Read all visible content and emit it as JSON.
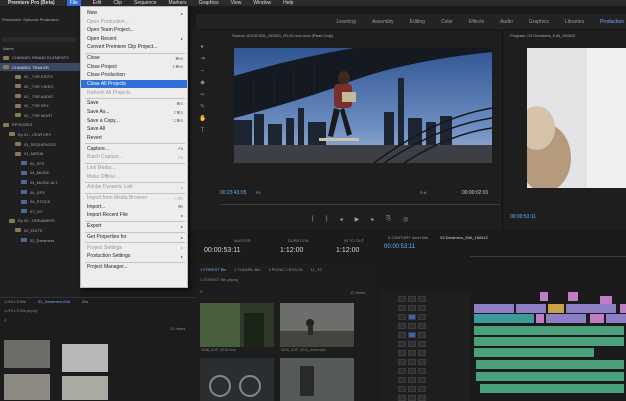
{
  "menubar": {
    "app": "Premiere Pro (Beta)",
    "items": [
      "File",
      "Edit",
      "Clip",
      "Sequence",
      "Markers",
      "Graphics",
      "View",
      "Window",
      "Help"
    ],
    "active": "File"
  },
  "workspaces": [
    "Learning",
    "Assembly",
    "Editing",
    "Color",
    "Effects",
    "Audio",
    "Graphics",
    "Libraries",
    "Production"
  ],
  "project": {
    "title": "Production: Episodic Production",
    "tree": [
      {
        "label": "Name",
        "indent": 0
      },
      {
        "label": "CHANNEL BRAND ELEMENTS",
        "indent": 0
      },
      {
        "label": "CHANNEL TRAILER",
        "indent": 0
      },
      {
        "label": "00 _TSR EDITS",
        "indent": 2
      },
      {
        "label": "00 _TSR VIDEO",
        "indent": 2
      },
      {
        "label": "00 _TSR AUDIO",
        "indent": 2
      },
      {
        "label": "00 _TSR SFX",
        "indent": 2
      },
      {
        "label": "00 _TSR MGRT",
        "indent": 2
      },
      {
        "label": "EPISODES",
        "indent": 0
      },
      {
        "label": "Ep 01 - CENTURY",
        "indent": 1
      },
      {
        "label": "01_SEQUENCES",
        "indent": 2
      },
      {
        "label": "01_MEDIA",
        "indent": 2
      },
      {
        "label": "04_SFX",
        "indent": 3
      },
      {
        "label": "04_MUSIC",
        "indent": 3
      },
      {
        "label": "04_MUSIC ALT",
        "indent": 3
      },
      {
        "label": "04_GFX",
        "indent": 3
      },
      {
        "label": "04_STOCK",
        "indent": 3
      },
      {
        "label": "07_VO",
        "indent": 3
      },
      {
        "label": "Ep 02 - DREAMERS",
        "indent": 1
      },
      {
        "label": "02_EDITS",
        "indent": 2
      },
      {
        "label": "02_Dreamers",
        "indent": 3
      }
    ]
  },
  "file_menu": {
    "items": [
      {
        "label": "New",
        "shortcut": "",
        "state": "normal",
        "arrow": true
      },
      {
        "label": "Open Production...",
        "shortcut": "",
        "state": "disabled"
      },
      {
        "label": "Open Team Project...",
        "shortcut": "",
        "state": "normal"
      },
      {
        "label": "Open Recent",
        "shortcut": "",
        "state": "normal",
        "arrow": true
      },
      {
        "label": "Convert Premiere Clip Project...",
        "shortcut": "",
        "state": "normal"
      },
      {
        "label": "Close",
        "shortcut": "⌘W",
        "state": "normal"
      },
      {
        "label": "Close Project",
        "shortcut": "⇧⌘W",
        "state": "normal"
      },
      {
        "label": "Close Production",
        "shortcut": "",
        "state": "normal"
      },
      {
        "label": "Close All Projects",
        "shortcut": "",
        "state": "highlighted"
      },
      {
        "label": "Refresh All Projects",
        "shortcut": "",
        "state": "disabled"
      },
      {
        "label": "Save",
        "shortcut": "⌘S",
        "state": "normal"
      },
      {
        "label": "Save As...",
        "shortcut": "⇧⌘S",
        "state": "normal"
      },
      {
        "label": "Save a Copy...",
        "shortcut": "⌥⌘S",
        "state": "normal"
      },
      {
        "label": "Save All",
        "shortcut": "",
        "state": "normal"
      },
      {
        "label": "Revert",
        "shortcut": "",
        "state": "normal"
      },
      {
        "label": "Capture...",
        "shortcut": "F5",
        "state": "normal"
      },
      {
        "label": "Batch Capture...",
        "shortcut": "F6",
        "state": "disabled"
      },
      {
        "label": "Link Media...",
        "shortcut": "",
        "state": "disabled"
      },
      {
        "label": "Make Offline...",
        "shortcut": "",
        "state": "disabled"
      },
      {
        "label": "Adobe Dynamic Link",
        "shortcut": "",
        "state": "disabled",
        "arrow": true
      },
      {
        "label": "Import from Media Browser",
        "shortcut": "⌥⌘I",
        "state": "disabled"
      },
      {
        "label": "Import...",
        "shortcut": "⌘I",
        "state": "normal"
      },
      {
        "label": "Import Recent File",
        "shortcut": "",
        "state": "normal",
        "arrow": true
      },
      {
        "label": "Export",
        "shortcut": "",
        "state": "normal",
        "arrow": true
      },
      {
        "label": "Get Properties for",
        "shortcut": "",
        "state": "normal",
        "arrow": true
      },
      {
        "label": "Project Settings",
        "shortcut": "",
        "state": "disabled",
        "arrow": true
      },
      {
        "label": "Production Settings",
        "shortcut": "",
        "state": "normal",
        "arrow": true
      },
      {
        "label": "Project Manager...",
        "shortcut": "",
        "state": "normal"
      }
    ]
  },
  "source_monitor": {
    "title": "Source: A013C026_160521_R1JC.mov.mov (Read Only)",
    "timecode": "00:23:43:05",
    "fit": "Fit",
    "quality": "Full",
    "duration": "00:00:02:01"
  },
  "program_monitor": {
    "title": "Program: 03 Dreamers_Edit_180612",
    "timecode": "00:00:53:11"
  },
  "metadata": {
    "master_label": "MASTER",
    "master_value": "00:00:53:11",
    "duration_label": "DURATION",
    "duration_value": "1:12:00",
    "in_to_out_label": "IN TO OUT",
    "in_to_out_value": "1:12:00"
  },
  "bin_panel": {
    "tabs": [
      "1 FOREST Bin",
      "2 TUNNEL Bin",
      "3 PICNIC LESSON",
      "11_TC"
    ],
    "selected_tab": "1 FOREST Bin",
    "path": "1-FOREST Bin.prproj",
    "item_count": "12 Items",
    "thumbs": [
      {
        "label": "0048_CLIP_0010.mov"
      },
      {
        "label": "0049_CLIP_0011_rmxb.mp4"
      },
      {
        "label": "0050_CLIP_0012.mov"
      },
      {
        "label": "0051_CLIP_0013.mov"
      }
    ]
  },
  "lower_left_bin": {
    "tabs": [
      "1-HS.LS Bin",
      "03_Dreamers Edit",
      "Bin"
    ],
    "selected_tab": "03_Dreamers Edit",
    "path": "1-HS.LS Bin.prproj",
    "item_count": "12 Items"
  },
  "timeline": {
    "tabs": [
      "0-CENTURY short film",
      "03 Dreamers_Edit_180612"
    ],
    "selected_tab": "03 Dreamers_Edit_180612",
    "timecode": "00:00:53:11"
  }
}
